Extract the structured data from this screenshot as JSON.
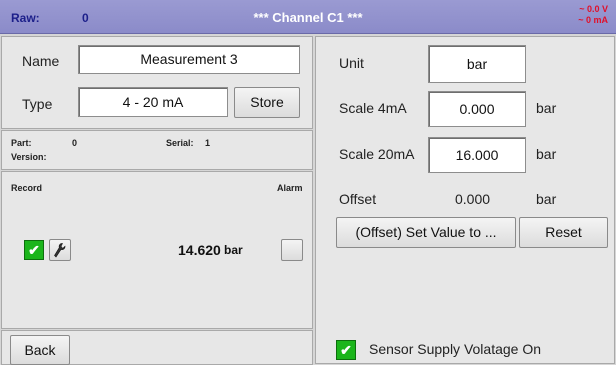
{
  "header": {
    "raw_label": "Raw:",
    "raw_value": "0",
    "title": "*** Channel C1 ***",
    "status_voltage": "~ 0.0 V",
    "status_current": "~ 0 mA"
  },
  "left": {
    "name_label": "Name",
    "name_value": "Measurement 3",
    "type_label": "Type",
    "type_value": "4 - 20 mA",
    "store_label": "Store",
    "part_label": "Part:",
    "part_value": "0",
    "serial_label": "Serial:",
    "serial_value": "1",
    "version_label": "Version:",
    "record_label": "Record",
    "alarm_label": "Alarm",
    "reading_value": "14.620",
    "reading_unit": "bar",
    "back_label": "Back"
  },
  "right": {
    "unit_label": "Unit",
    "unit_value": "bar",
    "scale4_label": "Scale 4mA",
    "scale4_value": "0.000",
    "scale4_unit": "bar",
    "scale20_label": "Scale 20mA",
    "scale20_value": "16.000",
    "scale20_unit": "bar",
    "offset_label": "Offset",
    "offset_value": "0.000",
    "offset_unit": "bar",
    "set_offset_label": "(Offset) Set Value to ...",
    "reset_label": "Reset",
    "sensor_supply_label": "Sensor Supply Volatage On"
  },
  "colors": {
    "header_bg": "#8b8bc9",
    "header_text": "#1c1f8a",
    "status_red": "#e0102a",
    "checkbox_green": "#1bb51b"
  },
  "icons": {
    "record_checkbox": "checkmark-icon",
    "record_settings": "wrench-icon",
    "sensor_checkbox": "checkmark-icon"
  }
}
